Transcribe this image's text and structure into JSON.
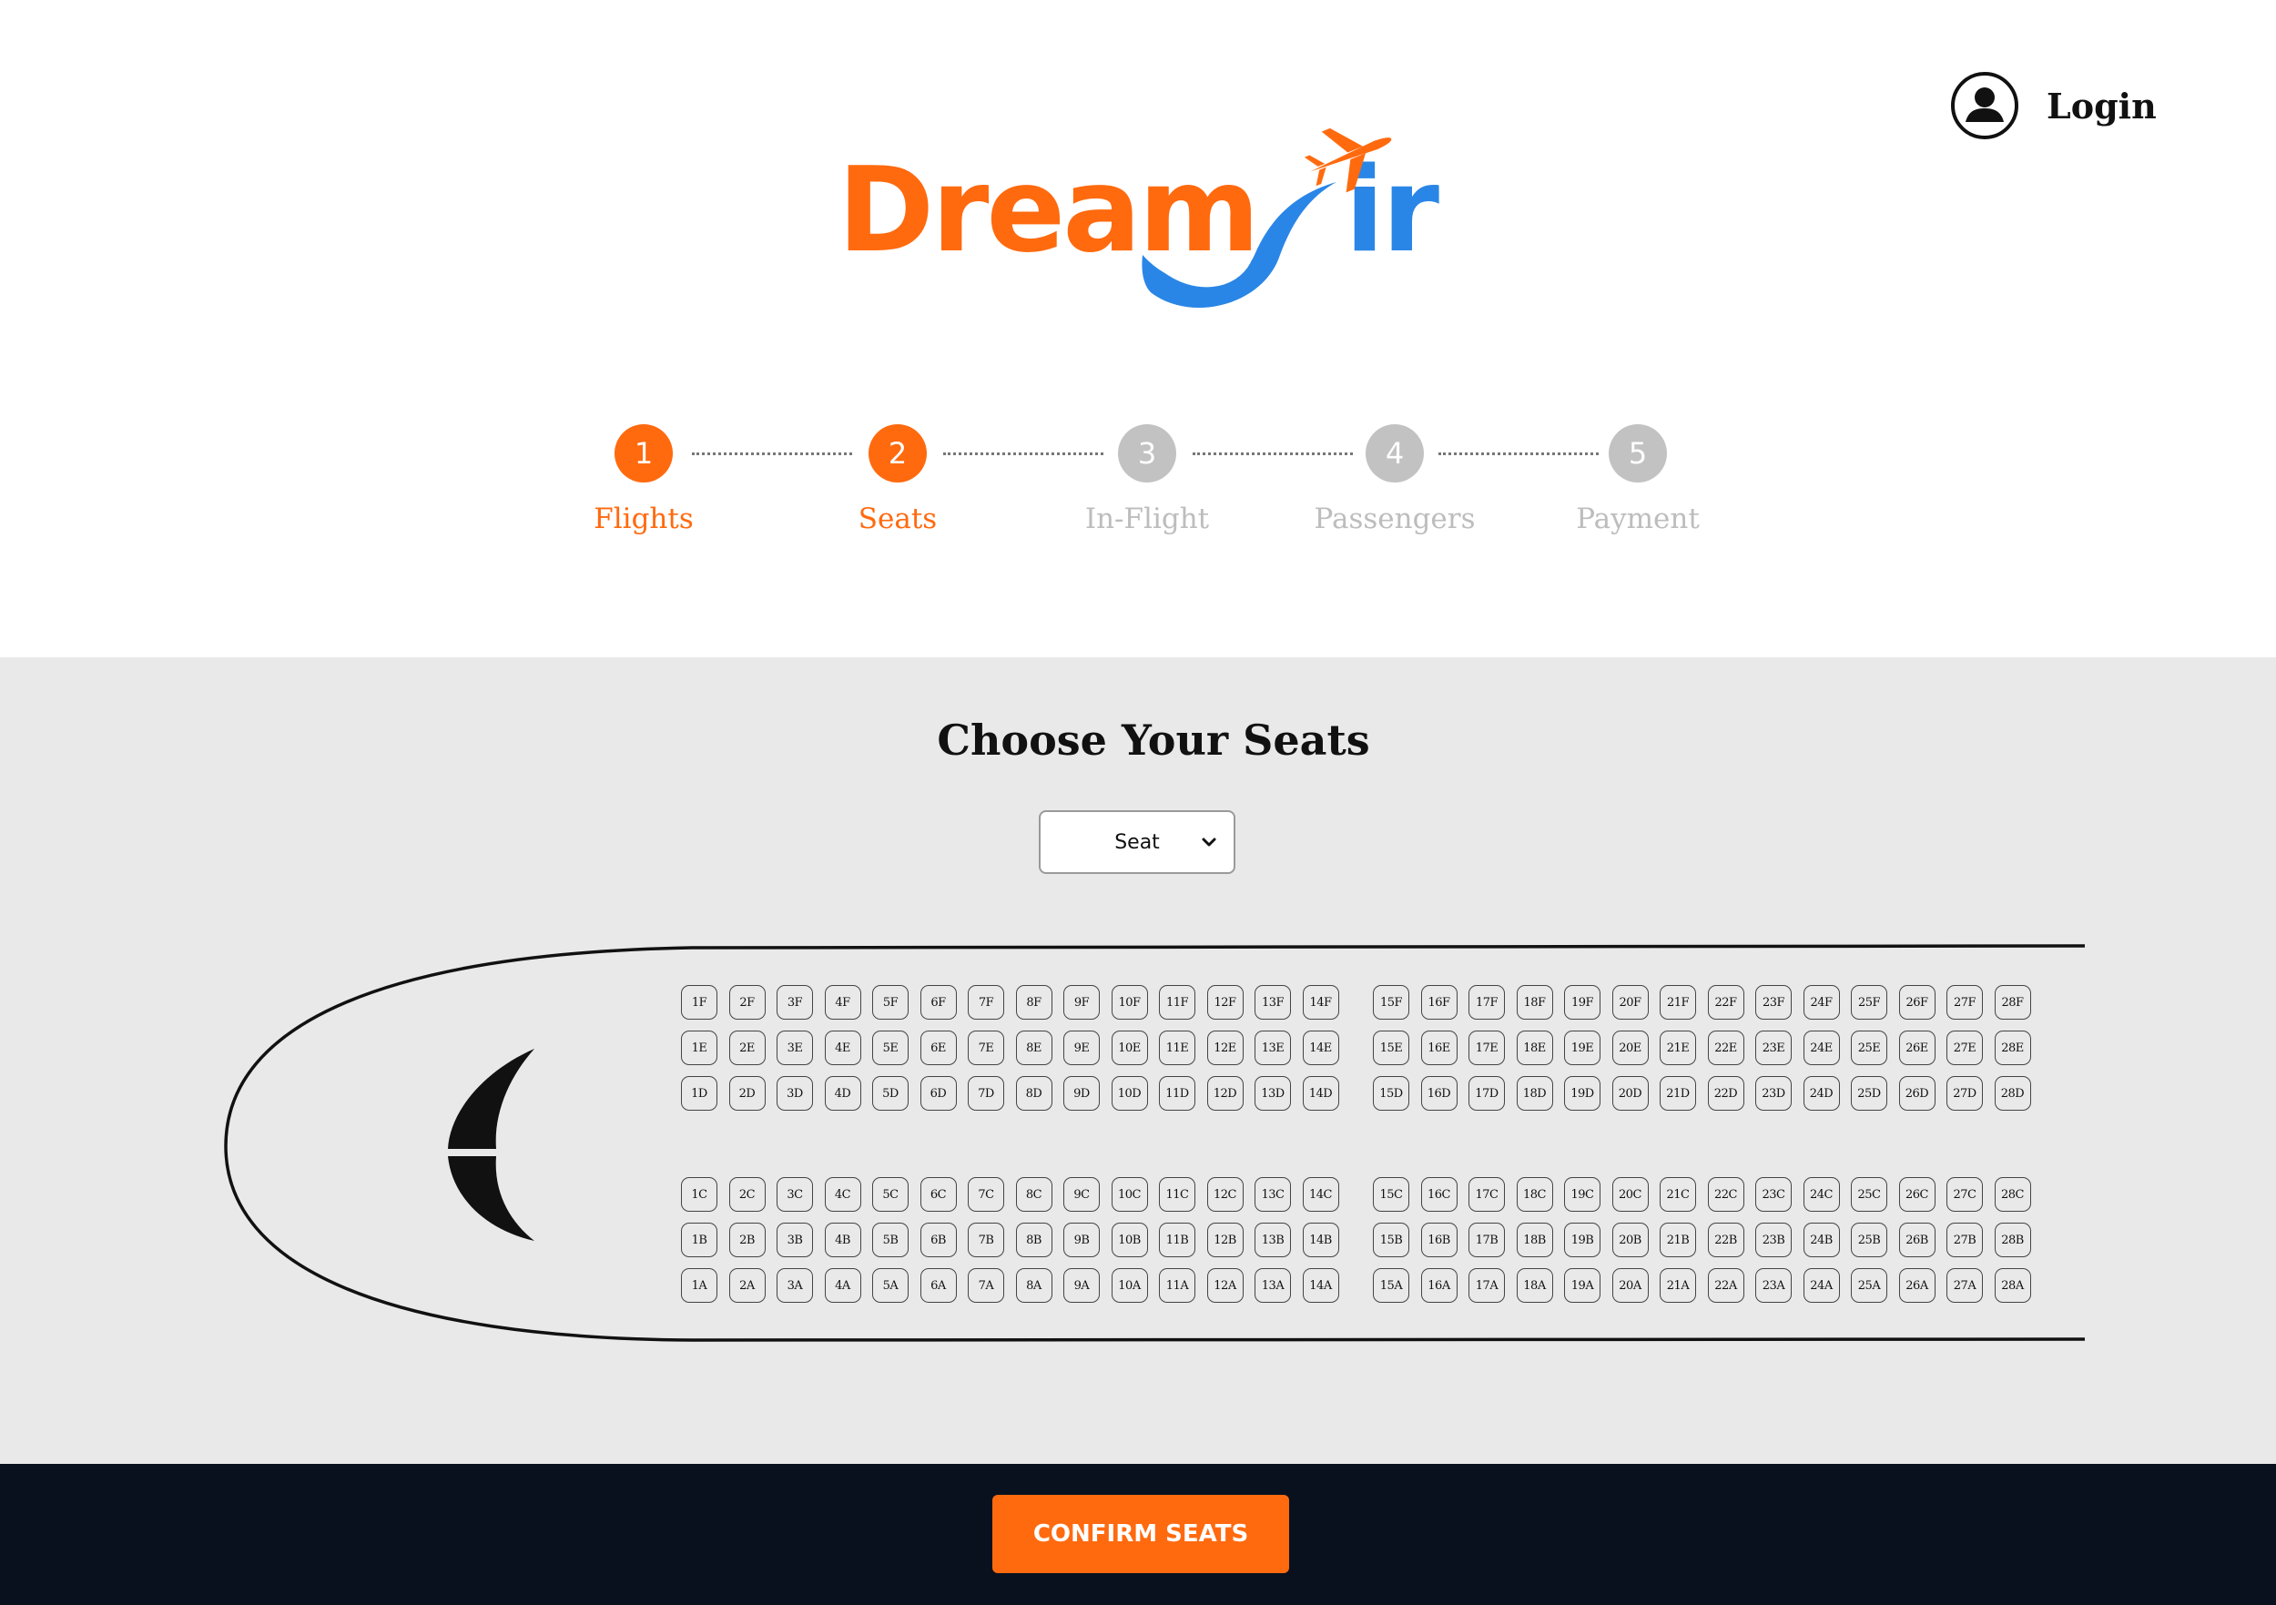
{
  "header": {
    "login_label": "Login",
    "user_icon": "user-circle-icon",
    "logo": {
      "part1": "Dream",
      "part2": "ir",
      "icon": "airplane-icon",
      "colors": {
        "dream": "#ff6a0f",
        "air": "#2a86e6"
      }
    }
  },
  "steps": [
    {
      "number": "1",
      "label": "Flights",
      "state": "active"
    },
    {
      "number": "2",
      "label": "Seats",
      "state": "active"
    },
    {
      "number": "3",
      "label": "In-Flight",
      "state": "inactive"
    },
    {
      "number": "4",
      "label": "Passengers",
      "state": "inactive"
    },
    {
      "number": "5",
      "label": "Payment",
      "state": "inactive"
    }
  ],
  "seat_map": {
    "title": "Choose Your Seats",
    "select": {
      "value": "Seat",
      "icon": "chevron-down-icon"
    },
    "upper_rows": [
      "F",
      "E",
      "D"
    ],
    "lower_rows": [
      "C",
      "B",
      "A"
    ],
    "rows_first_block": [
      "1",
      "2",
      "3",
      "4",
      "5",
      "6",
      "7",
      "8",
      "9",
      "10",
      "11",
      "12",
      "13",
      "14"
    ],
    "rows_second_block": [
      "15",
      "16",
      "17",
      "18",
      "19",
      "20",
      "21",
      "22",
      "23",
      "24",
      "25",
      "26",
      "27",
      "28"
    ]
  },
  "footer": {
    "confirm_label": "CONFIRM SEATS"
  },
  "colors": {
    "accent": "#ff6a0f",
    "inactive": "#c2c2c2",
    "footer_bg": "#09111e",
    "seat_area_bg": "#e9e9e9"
  }
}
